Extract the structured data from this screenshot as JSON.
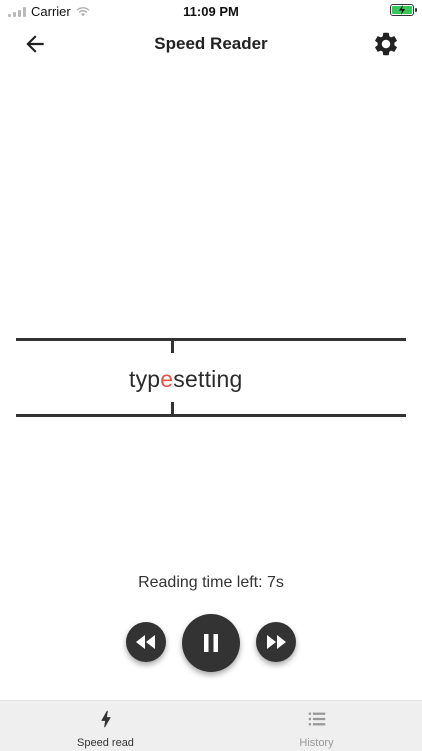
{
  "status_bar": {
    "carrier": "Carrier",
    "time": "11:09 PM",
    "battery_color": "#34c759"
  },
  "nav": {
    "title": "Speed Reader",
    "back_icon": "arrow-left-icon",
    "settings_icon": "gear-icon"
  },
  "reader": {
    "word_before": "typ",
    "word_pivot": "e",
    "word_after": "setting",
    "pivot_color": "#e5534b"
  },
  "playback": {
    "time_left_label": "Reading time left: 7s",
    "rewind_icon": "rewind-icon",
    "pause_icon": "pause-icon",
    "forward_icon": "fast-forward-icon"
  },
  "tabs": [
    {
      "label": "Speed read",
      "icon": "lightning-icon",
      "active": true
    },
    {
      "label": "History",
      "icon": "list-icon",
      "active": false
    }
  ]
}
